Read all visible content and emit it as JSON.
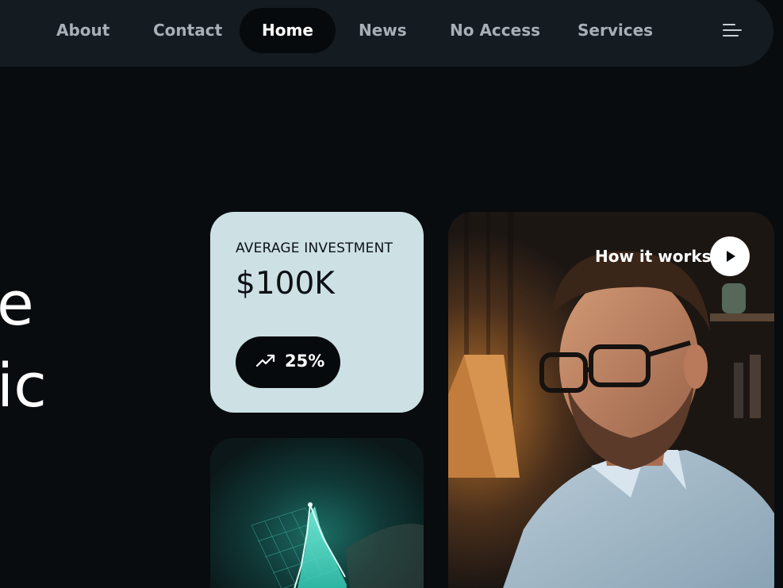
{
  "nav": {
    "items": [
      {
        "label": "About",
        "active": false
      },
      {
        "label": "Contact",
        "active": false
      },
      {
        "label": "Home",
        "active": true
      },
      {
        "label": "News",
        "active": false
      },
      {
        "label": "No Access",
        "active": false
      },
      {
        "label": "Services",
        "active": false
      }
    ],
    "menu_icon": "menu-lines-icon"
  },
  "hero": {
    "line1_fragment": "e",
    "line2_fragment": "ic"
  },
  "investment_card": {
    "label": "AVERAGE INVESTMENT",
    "value": "$100K",
    "growth_icon": "trending-up-icon",
    "growth": "25%"
  },
  "video_card": {
    "cta_label": "How it works",
    "play_icon": "play-icon"
  },
  "colors": {
    "background": "#080c0f",
    "nav_background": "#141b21",
    "card_accent": "#cde1e5",
    "chart_glow": "#3ee6c8"
  }
}
